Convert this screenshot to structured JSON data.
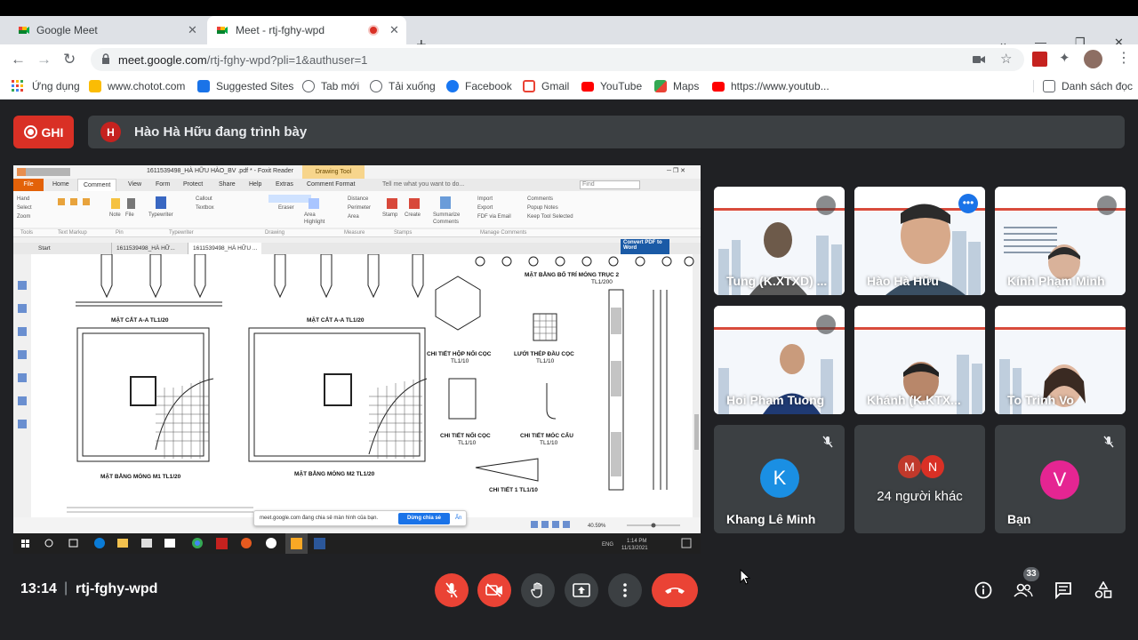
{
  "browser": {
    "tabs": [
      {
        "title": "Google Meet",
        "active": false
      },
      {
        "title": "Meet - rtj-fghy-wpd",
        "active": true,
        "recording": true
      }
    ],
    "url_host": "meet.google.com",
    "url_path": "/rtj-fghy-wpd?pli=1&authuser=1",
    "bookmarks": [
      {
        "label": "Ứng dụng",
        "icon": "apps-grid-icon"
      },
      {
        "label": "www.chotot.com",
        "icon": "chotot-icon"
      },
      {
        "label": "Suggested Sites",
        "icon": "bing-icon"
      },
      {
        "label": "Tab mới",
        "icon": "globe-icon"
      },
      {
        "label": "Tải xuống",
        "icon": "globe-icon"
      },
      {
        "label": "Facebook",
        "icon": "facebook-icon"
      },
      {
        "label": "Gmail",
        "icon": "gmail-icon"
      },
      {
        "label": "YouTube",
        "icon": "youtube-icon"
      },
      {
        "label": "Maps",
        "icon": "maps-icon"
      },
      {
        "label": "https://www.youtub...",
        "icon": "youtube-icon"
      }
    ],
    "reading_list": "Danh sách đọc"
  },
  "meet": {
    "record_label": "GHI",
    "presenter_initial": "H",
    "presenting_text": "Hào Hà Hữu đang trình bày",
    "time": "13:14",
    "meeting_code": "rtj-fghy-wpd",
    "people_count": "33",
    "participants": [
      {
        "name": "Tung (K.XTXD) ...",
        "type": "video",
        "muted": true
      },
      {
        "name": "Hào Hà Hữu",
        "type": "video",
        "muted": false,
        "highlighted": true
      },
      {
        "name": "Kính Phạm Minh",
        "type": "video",
        "muted": true
      },
      {
        "name": "Hoi Pham Tuong",
        "type": "video",
        "muted": true
      },
      {
        "name": "Khánh (K.KTX...",
        "type": "video",
        "muted": false
      },
      {
        "name": "To Trinh Vo",
        "type": "video",
        "muted": false
      },
      {
        "name": "Khang Lê Minh",
        "type": "avatar",
        "initial": "K",
        "color": "#1a8fe3",
        "muted": true
      },
      {
        "name": "24 người khác",
        "type": "group",
        "initials": [
          "M",
          "N"
        ],
        "colors": [
          "#c0392b",
          "#d93025"
        ]
      },
      {
        "name": "Bạn",
        "type": "avatar",
        "initial": "V",
        "color": "#e52592",
        "muted": true
      }
    ]
  },
  "shared_screen": {
    "foxit_title": "1611539498_HÀ HỮU HÀO_BV .pdf * - Foxit Reader",
    "drawing_tool_tab": "Drawing Tool",
    "ribbon_tabs": [
      "File",
      "Home",
      "Comment",
      "View",
      "Form",
      "Protect",
      "Share",
      "Help",
      "Extras",
      "Comment Format"
    ],
    "tell_me": "Tell me what you want to do...",
    "find": "Find",
    "doc_tabs": [
      "Start",
      "1611539498_HÀ HỮ...",
      "1611539498_HÀ HỮU ..."
    ],
    "convert": "Convert PDF to Word",
    "drawing_labels": [
      "MẶT CẮT A-A TL1/20",
      "MẶT CẮT A-A TL1/20",
      "MẶT BẰNG BỐ TRÍ MÓNG TRỤC 2",
      "TL1/200",
      "CHI TIẾT HỘP NỐI CỌC",
      "TL1/10",
      "LƯỚI THÉP ĐẦU CỌC",
      "TL1/10",
      "CHI TIẾT NỐI CỌC",
      "TL1/10",
      "CHI TIẾT MÓC CẨU",
      "TL1/10",
      "MẶT BẰNG MÓNG M1 TL1/20",
      "MẶT BẰNG MÓNG M2 TL1/20",
      "CHI TIẾT 1 TL1/10"
    ],
    "share_notice": "meet.google.com đang chia sẻ màn hình của bạn.",
    "stop_share": "Dừng chia sẻ",
    "hide": "Ẩn",
    "zoom": "40.59%",
    "clock_time": "1:14 PM",
    "clock_date": "11/13/2021",
    "lang": "ENG"
  }
}
